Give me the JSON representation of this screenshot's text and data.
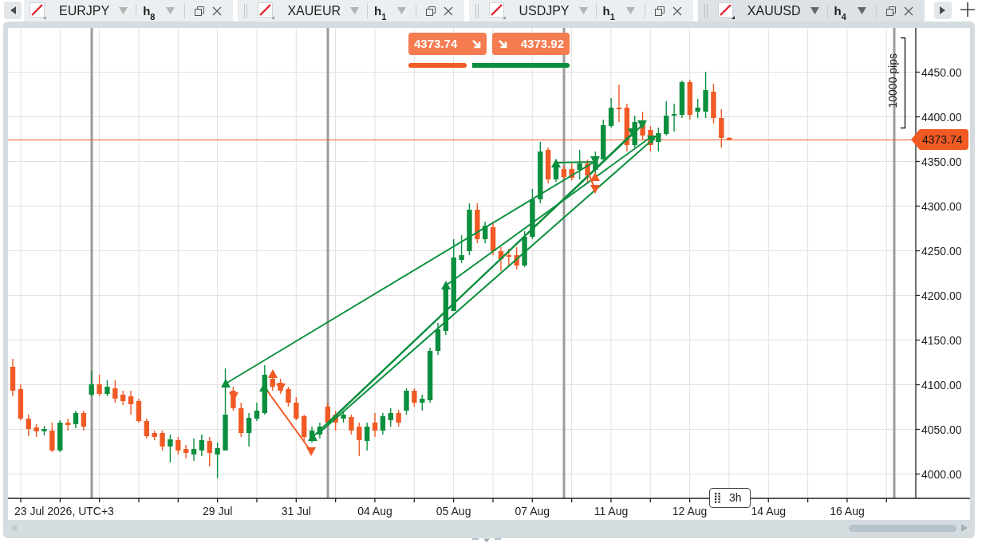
{
  "tabs": [
    {
      "symbol": "EURJPY",
      "timeframe": "h$_{8}$",
      "selected": false,
      "drag_handle": false
    },
    {
      "symbol": "XAUEUR",
      "timeframe": "h$_{1}$",
      "selected": false,
      "drag_handle": true
    },
    {
      "symbol": "USDJPY",
      "timeframe": "h$_{1}$",
      "selected": false,
      "drag_handle": true
    },
    {
      "symbol": "XAUUSD",
      "timeframe": "h$_{4}$",
      "selected": true,
      "drag_handle": true
    }
  ],
  "trade_panel": {
    "sell_price": "4373.74",
    "buy_price": "4373.92",
    "sentiment": {
      "level": 0.36
    }
  },
  "chart": {
    "pip_ruler": "10000 pips",
    "current_price": "4373.74",
    "price_labels": [
      "4450.00",
      "4400.00",
      "4350.00",
      "4300.00",
      "4250.00",
      "4200.00",
      "4150.00",
      "4100.00",
      "4050.00",
      "4000.00"
    ],
    "time_labels": [
      "23 Jul 2026, UTC+3",
      "29 Jul",
      "31 Jul",
      "04 Aug",
      "05 Aug",
      "07 Aug",
      "11 Aug",
      "12 Aug",
      "14 Aug",
      "16 Aug"
    ],
    "crosshair_time": "3h"
  }
}
